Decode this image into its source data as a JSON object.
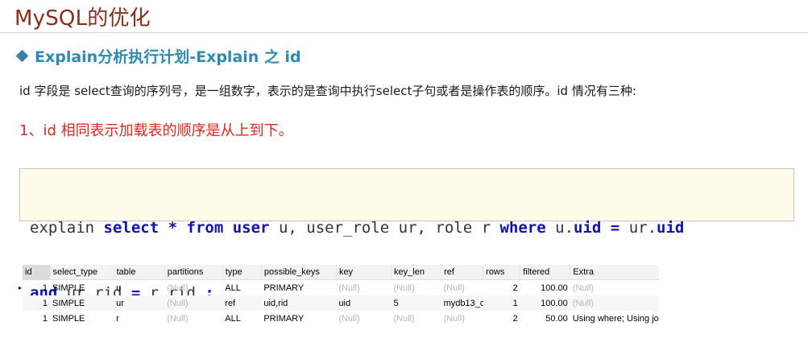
{
  "slide": {
    "title": "MySQL的优化",
    "subheading": "Explain分析执行计划-Explain 之 id",
    "paragraph": "id 字段是 select查询的序列号，是一组数字，表示的是查询中执行select子句或者是操作表的顺序。id 情况有三种:",
    "point": "1、id 相同表示加载表的顺序是从上到下。"
  },
  "code": {
    "line1": [
      {
        "t": "explain ",
        "kw": false
      },
      {
        "t": "select",
        "kw": true
      },
      {
        "t": " ",
        "kw": false
      },
      {
        "t": "*",
        "kw": true
      },
      {
        "t": " ",
        "kw": false
      },
      {
        "t": "from",
        "kw": true
      },
      {
        "t": " ",
        "kw": false
      },
      {
        "t": "user",
        "kw": true
      },
      {
        "t": " u, user_role ur, role r ",
        "kw": false
      },
      {
        "t": "where",
        "kw": true
      },
      {
        "t": " u.",
        "kw": false
      },
      {
        "t": "uid",
        "kw": true
      },
      {
        "t": " ",
        "kw": false
      },
      {
        "t": "=",
        "kw": true
      },
      {
        "t": " ur.",
        "kw": false
      },
      {
        "t": "uid",
        "kw": true
      }
    ],
    "line2": [
      {
        "t": "and",
        "kw": true
      },
      {
        "t": " ur.rid ",
        "kw": false
      },
      {
        "t": "=",
        "kw": true
      },
      {
        "t": " r.rid ",
        "kw": false
      },
      {
        "t": ";",
        "kw": true
      }
    ]
  },
  "result_grid": {
    "columns": [
      "id",
      "select_type",
      "table",
      "partitions",
      "type",
      "possible_keys",
      "key",
      "key_len",
      "ref",
      "rows",
      "filtered",
      "Extra"
    ],
    "rows": [
      [
        "1",
        "SIMPLE",
        "u",
        "(Null)",
        "ALL",
        "PRIMARY",
        "(Null)",
        "(Null)",
        "(Null)",
        "2",
        "100.00",
        "(Null)"
      ],
      [
        "1",
        "SIMPLE",
        "ur",
        "(Null)",
        "ref",
        "uid,rid",
        "uid",
        "5",
        "mydb13_c",
        "1",
        "100.00",
        "(Null)"
      ],
      [
        "1",
        "SIMPLE",
        "r",
        "(Null)",
        "ALL",
        "PRIMARY",
        "(Null)",
        "(Null)",
        "(Null)",
        "2",
        "50.00",
        "Using where; Using jo"
      ]
    ],
    "current_row_marker": "▸"
  },
  "colors": {
    "title": "#8b2d1d",
    "subheading": "#2d8bb3",
    "point": "#d62a1e",
    "keyword": "#1010b3",
    "code_bg": "#fefce8"
  }
}
